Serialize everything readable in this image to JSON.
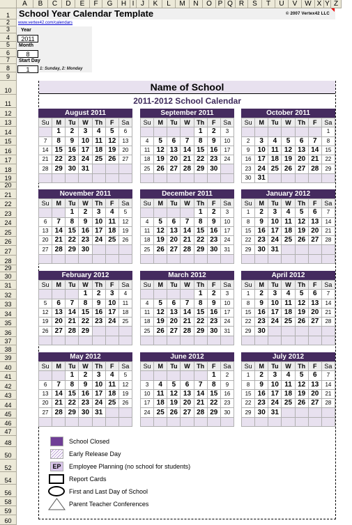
{
  "spreadsheet": {
    "columns": [
      "A",
      "B",
      "C",
      "D",
      "E",
      "F",
      "G",
      "H",
      "I",
      "J",
      "K",
      "L",
      "M",
      "N",
      "O",
      "P",
      "Q",
      "R",
      "S",
      "T",
      "U",
      "V",
      "W",
      "X",
      "Y",
      "Z"
    ],
    "rows": [
      "1",
      "2",
      "3",
      "4",
      "5",
      "6",
      "7",
      "8",
      "9",
      "10",
      "11",
      "12",
      "13",
      "14",
      "15",
      "16",
      "17",
      "18",
      "19",
      "20",
      "21",
      "22",
      "23",
      "24",
      "25",
      "26",
      "27",
      "28",
      "29",
      "30",
      "31",
      "32",
      "33",
      "34",
      "35",
      "36",
      "37",
      "38",
      "39",
      "40",
      "41",
      "42",
      "43",
      "44",
      "45",
      "46",
      "47",
      "48",
      "50",
      "52",
      "54",
      "56",
      "58",
      "59",
      "60"
    ]
  },
  "header": {
    "title": "School Year Calendar Template",
    "link": "www.vertex42.com/calendars",
    "copyright": "© 2007 Vertex42 LLC"
  },
  "settings": {
    "year_label": "Year",
    "year_value": "2011",
    "month_label": "Month",
    "month_value": "8",
    "start_day_label": "Start Day",
    "start_day_value": "1",
    "start_day_hint": "1: Sunday, 2: Monday"
  },
  "calendar": {
    "school_name": "Name of School",
    "year_title": "2011-2012 School Calendar",
    "weekdays": [
      "Su",
      "M",
      "Tu",
      "W",
      "Th",
      "F",
      "Sa"
    ],
    "months": [
      {
        "name": "August 2011",
        "start": 1,
        "days": 31
      },
      {
        "name": "September 2011",
        "start": 4,
        "days": 30
      },
      {
        "name": "October 2011",
        "start": 6,
        "days": 31
      },
      {
        "name": "November 2011",
        "start": 2,
        "days": 30
      },
      {
        "name": "December 2011",
        "start": 4,
        "days": 31
      },
      {
        "name": "January 2012",
        "start": 0,
        "days": 31
      },
      {
        "name": "February 2012",
        "start": 3,
        "days": 29
      },
      {
        "name": "March 2012",
        "start": 4,
        "days": 31
      },
      {
        "name": "April 2012",
        "start": 0,
        "days": 30
      },
      {
        "name": "May 2012",
        "start": 2,
        "days": 31
      },
      {
        "name": "June 2012",
        "start": 5,
        "days": 30
      },
      {
        "name": "July 2012",
        "start": 0,
        "days": 31
      }
    ]
  },
  "legend": [
    {
      "icon": "school-closed-swatch",
      "label": "School Closed"
    },
    {
      "icon": "early-release-swatch",
      "label": "Early Release Day"
    },
    {
      "icon": "employee-planning-swatch",
      "code": "EP",
      "label": "Employee Planning (no school for students)"
    },
    {
      "icon": "report-cards-rectangle",
      "label": "Report Cards"
    },
    {
      "icon": "first-last-day-oval",
      "label": "First and Last Day of School"
    },
    {
      "icon": "conference-triangle",
      "label": "Parent Teacher Conferences"
    }
  ],
  "colors": {
    "month_header": "#452b5f",
    "empty_cell": "#e8e1ef",
    "school_closed": "#6f3e96",
    "year_title": "#3f2b5c",
    "link": "#0000cc"
  }
}
